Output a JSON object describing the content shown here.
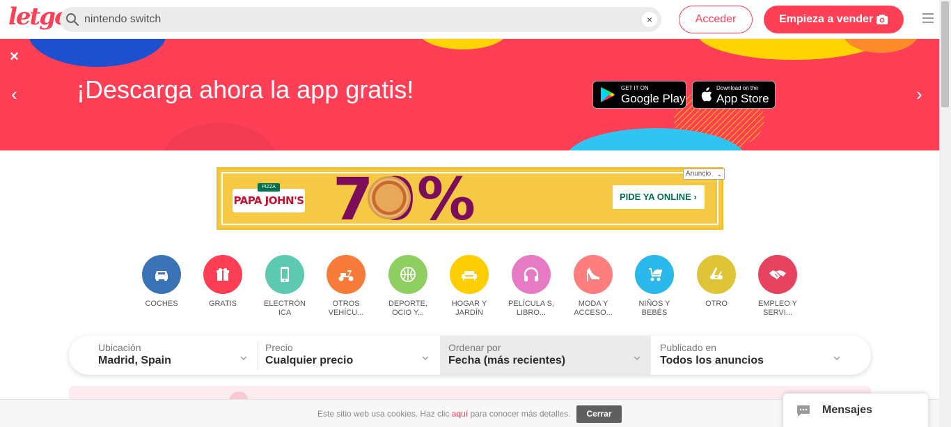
{
  "header": {
    "logo": "letgo",
    "search_value": "nintendo switch",
    "clear_label": "×",
    "login_label": "Acceder",
    "sell_label": "Empieza a vender"
  },
  "banner": {
    "title": "¡Descarga ahora la app gratis!",
    "close_label": "×",
    "prev_label": "‹",
    "next_label": "›",
    "google_play": {
      "small": "GET IT ON",
      "big": "Google Play"
    },
    "app_store": {
      "small": "Download on the",
      "big": "App Store"
    }
  },
  "ad": {
    "tag": "Anuncio",
    "brand_sub": "PIZZA",
    "brand": "PAPA JOHN'S",
    "promo": "70%",
    "cta": "PIDE YA ONLINE ›"
  },
  "categories": [
    {
      "label": "COCHES",
      "color": "#3a72b6",
      "icon": "car-icon"
    },
    {
      "label": "GRATIS",
      "color": "#ff3f55",
      "icon": "gift-icon"
    },
    {
      "label": "ELECTRÓN ICA",
      "color": "#5dc9b0",
      "icon": "phone-icon"
    },
    {
      "label": "OTROS VEHÍCU...",
      "color": "#f77c3a",
      "icon": "scooter-icon"
    },
    {
      "label": "DEPORTE, OCIO Y...",
      "color": "#8fcf61",
      "icon": "basketball-icon"
    },
    {
      "label": "HOGAR Y JARDÍN",
      "color": "#ffce00",
      "icon": "sofa-icon"
    },
    {
      "label": "PELÍCULA S, LIBRO...",
      "color": "#e77ac4",
      "icon": "headphones-icon"
    },
    {
      "label": "MODA Y ACCESO...",
      "color": "#ff7d7d",
      "icon": "heel-icon"
    },
    {
      "label": "NIÑOS Y BEBÉS",
      "color": "#2ab7ea",
      "icon": "stroller-icon"
    },
    {
      "label": "OTRO",
      "color": "#e0c437",
      "icon": "swiss-knife-icon"
    },
    {
      "label": "EMPLEO Y SERVI...",
      "color": "#e8435e",
      "icon": "handshake-icon"
    }
  ],
  "filters": {
    "location": {
      "label": "Ubicación",
      "value": "Madrid, Spain"
    },
    "price": {
      "label": "Precio",
      "value": "Cualquier precio"
    },
    "sort": {
      "label": "Ordenar por",
      "value": "Fecha (más recientes)"
    },
    "published": {
      "label": "Publicado en",
      "value": "Todos los anuncios"
    }
  },
  "cookies": {
    "text_before": "Este sitio web usa cookies. Haz clic ",
    "link": "aquí",
    "text_after": " para conocer más detalles.",
    "button": "Cerrar"
  },
  "messages": {
    "label": "Mensajes"
  },
  "colors": {
    "brand": "#ff3f55"
  }
}
